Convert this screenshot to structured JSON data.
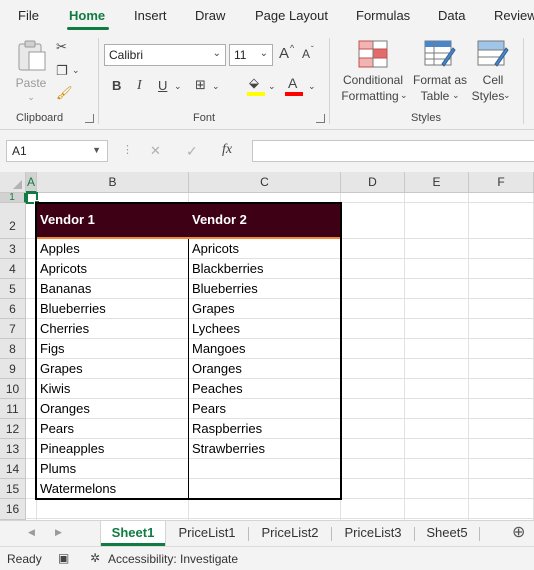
{
  "ribbon_tabs": [
    {
      "label": "File"
    },
    {
      "label": "Home"
    },
    {
      "label": "Insert"
    },
    {
      "label": "Draw"
    },
    {
      "label": "Page Layout"
    },
    {
      "label": "Formulas"
    },
    {
      "label": "Data"
    },
    {
      "label": "Review"
    }
  ],
  "active_tab": "Home",
  "clipboard": {
    "paste_label": "Paste",
    "group_label": "Clipboard"
  },
  "font": {
    "name": "Calibri",
    "size": "11",
    "group_label": "Font",
    "bold": "B",
    "italic": "I",
    "underline": "U",
    "grow": "A",
    "shrink": "A",
    "font_color": "A"
  },
  "styles": {
    "conditional_line1": "Conditional",
    "conditional_line2": "Formatting",
    "format_table_line1": "Format as",
    "format_table_line2": "Table",
    "cell_styles_line1": "Cell",
    "cell_styles_line2": "Styles",
    "group_label": "Styles"
  },
  "formula_bar": {
    "name_box": "A1",
    "cancel": "✕",
    "enter": "✓",
    "fx": "fx",
    "formula": ""
  },
  "columns": [
    "A",
    "B",
    "C",
    "D",
    "E",
    "F"
  ],
  "rows": [
    "1",
    "2",
    "3",
    "4",
    "5",
    "6",
    "7",
    "8",
    "9",
    "10",
    "11",
    "12",
    "13",
    "14",
    "15",
    "16"
  ],
  "table": {
    "headers": [
      "Vendor 1",
      "Vendor 2"
    ],
    "vendor1": [
      "Apples",
      "Apricots",
      "Bananas",
      "Blueberries",
      "Cherries",
      "Figs",
      "Grapes",
      "Kiwis",
      "Oranges",
      "Pears",
      "Pineapples",
      "Plums",
      "Watermelons"
    ],
    "vendor2": [
      "Apricots",
      "Blackberries",
      "Blueberries",
      "Grapes",
      "Lychees",
      "Mangoes",
      "Oranges",
      "Peaches",
      "Pears",
      "Raspberries",
      "Strawberries"
    ]
  },
  "sheet_tabs": [
    {
      "label": "Sheet1"
    },
    {
      "label": "PriceList1"
    },
    {
      "label": "PriceList2"
    },
    {
      "label": "PriceList3"
    },
    {
      "label": "Sheet5"
    }
  ],
  "active_sheet": "Sheet1",
  "status": {
    "ready": "Ready",
    "accessibility": "Accessibility: Investigate"
  },
  "colors": {
    "accent": "#107c41",
    "header_fill": "#3d0014",
    "header_accent": "#ec8c3a"
  }
}
